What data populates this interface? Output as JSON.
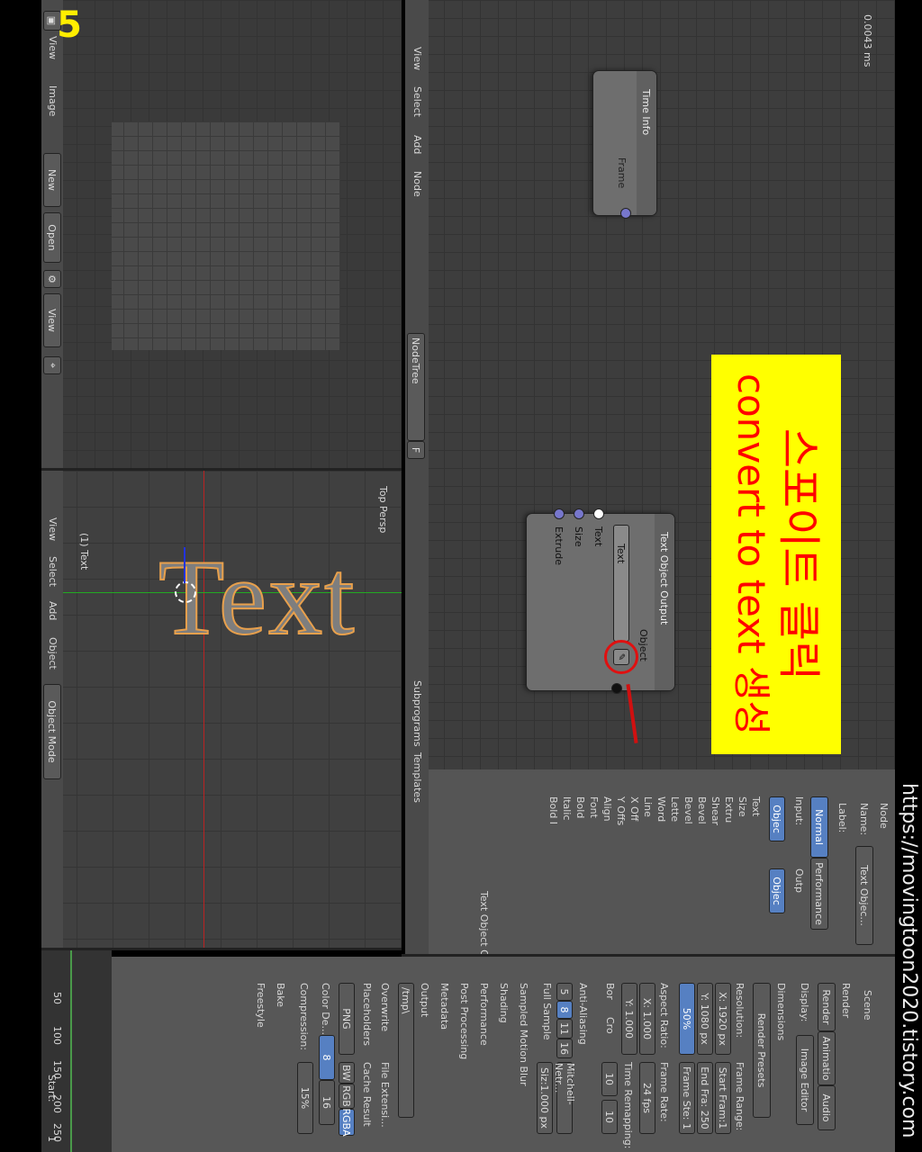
{
  "watermark": "https://movingtoon2020.tistory.com",
  "step_badge": "5",
  "annotation": {
    "line1": "스포이트 클릭",
    "line2": "convert to text 생성",
    "bg_color": "#ffff00",
    "text_color": "#ff0000"
  },
  "image_editor": {
    "menu": [
      "View",
      "Image"
    ],
    "new_label": "New",
    "open_label": "Open",
    "view_label": "View"
  },
  "viewport3d": {
    "perspective_label": "Top Persp",
    "object_label": "(1) Text",
    "menu": [
      "View",
      "Select",
      "Add",
      "Object"
    ],
    "mode": "Object Mode",
    "text_object": "Text"
  },
  "node_editor": {
    "timing": "0.0043 ms",
    "menu": [
      "View",
      "Select",
      "Add",
      "Node"
    ],
    "tree_name": "NodeTree",
    "fake_user": "F",
    "subprograms": "Subprograms",
    "templates": "Templates",
    "time_info_node": {
      "title": "Time Info",
      "output": "Frame"
    },
    "text_output_node": {
      "title": "Text Object Output",
      "object_label": "Object",
      "object_value": "Text",
      "inputs": [
        "Text",
        "Size",
        "Extrude"
      ]
    }
  },
  "node_sidebar": {
    "section": "Node",
    "name_label": "Name:",
    "name_value": "Text Objec...",
    "label_label": "Label:",
    "tabs": [
      "Normal",
      "Performance"
    ],
    "input_label": "Input:",
    "output_label": "Outp",
    "objec": "Objec",
    "input_rows": [
      "Text",
      "Size",
      "Extru",
      "Shear",
      "Bevel",
      "Bevel",
      "Lette",
      "Word",
      "Line",
      "X Off",
      "Y Offs",
      "Align",
      "Font",
      "Bold",
      "Italic",
      "Bold I"
    ],
    "cutoff_text": "Text Object Outp..."
  },
  "properties": {
    "scene_label": "Scene",
    "render_section": "Render",
    "render_btn": "Render",
    "animation_btn": "Animatio",
    "audio_btn": "Audio",
    "display_label": "Display:",
    "display_value": "Image Editor",
    "dimensions_section": "Dimensions",
    "render_presets": "Render Presets",
    "resolution_label": "Resolution:",
    "res_x": "X: 1920 px",
    "res_y": "Y: 1080 px",
    "res_pct": "50%",
    "frame_range_label": "Frame Range:",
    "start_frame": "Start Fram:1",
    "end_frame": "End Fra: 250",
    "frame_step": "Frame Ste: 1",
    "aspect_label": "Aspect Ratio:",
    "aspect_x": "X: 1.000",
    "aspect_y": "Y: 1.000",
    "frame_rate_label": "Frame Rate:",
    "fps": "24 fps",
    "bor": "Bor",
    "cro": "Cro",
    "time_remap_label": "Time Remapping:",
    "remap_old": "10",
    "remap_new": "10",
    "aa_section": "Anti-Aliasing",
    "aa_samples": [
      "5",
      "8",
      "11",
      "16"
    ],
    "aa_filter": "Mitchell-Netr...",
    "full_sample": "Full Sample",
    "filter_size": "Siz:1.000 px",
    "motion_blur": "Sampled Motion Blur",
    "shading": "Shading",
    "performance": "Performance",
    "post_processing": "Post Processing",
    "metadata": "Metadata",
    "output_section": "Output",
    "output_path": "/tmp\\",
    "overwrite": "Overwrite",
    "file_ext": "File Extensi...",
    "placeholders": "Placeholders",
    "cache_result": "Cache Result",
    "format": "PNG",
    "bw": "BW",
    "rgb": "RGB",
    "rgba": "RGBA",
    "color_depth_label": "Color De...",
    "depth_8": "8",
    "depth_16": "16",
    "compression_label": "Compression:",
    "compression_value": "15%",
    "bake": "Bake",
    "freestyle": "Freestyle"
  },
  "timeline": {
    "ticks": [
      "50",
      "100",
      "150",
      "200",
      "250"
    ],
    "start_label": "Start:",
    "start_value": "1"
  }
}
